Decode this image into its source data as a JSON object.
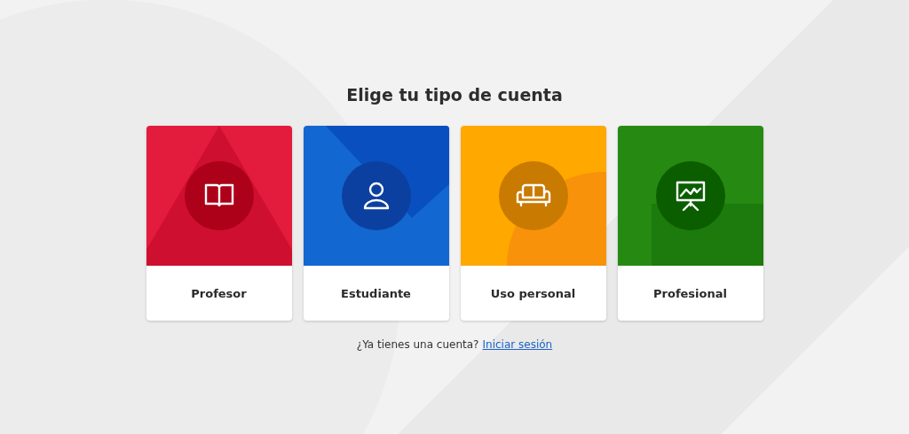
{
  "title": "Elige tu tipo de cuenta",
  "cards": [
    {
      "label": "Profesor",
      "kind": "teacher",
      "color": "#e31b3c"
    },
    {
      "label": "Estudiante",
      "kind": "student",
      "color": "#1367d0"
    },
    {
      "label": "Uso personal",
      "kind": "personal",
      "color": "#ffa800"
    },
    {
      "label": "Profesional",
      "kind": "professional",
      "color": "#268a12"
    }
  ],
  "footer": {
    "text": "¿Ya tienes una cuenta?",
    "link": "Iniciar sesión"
  }
}
